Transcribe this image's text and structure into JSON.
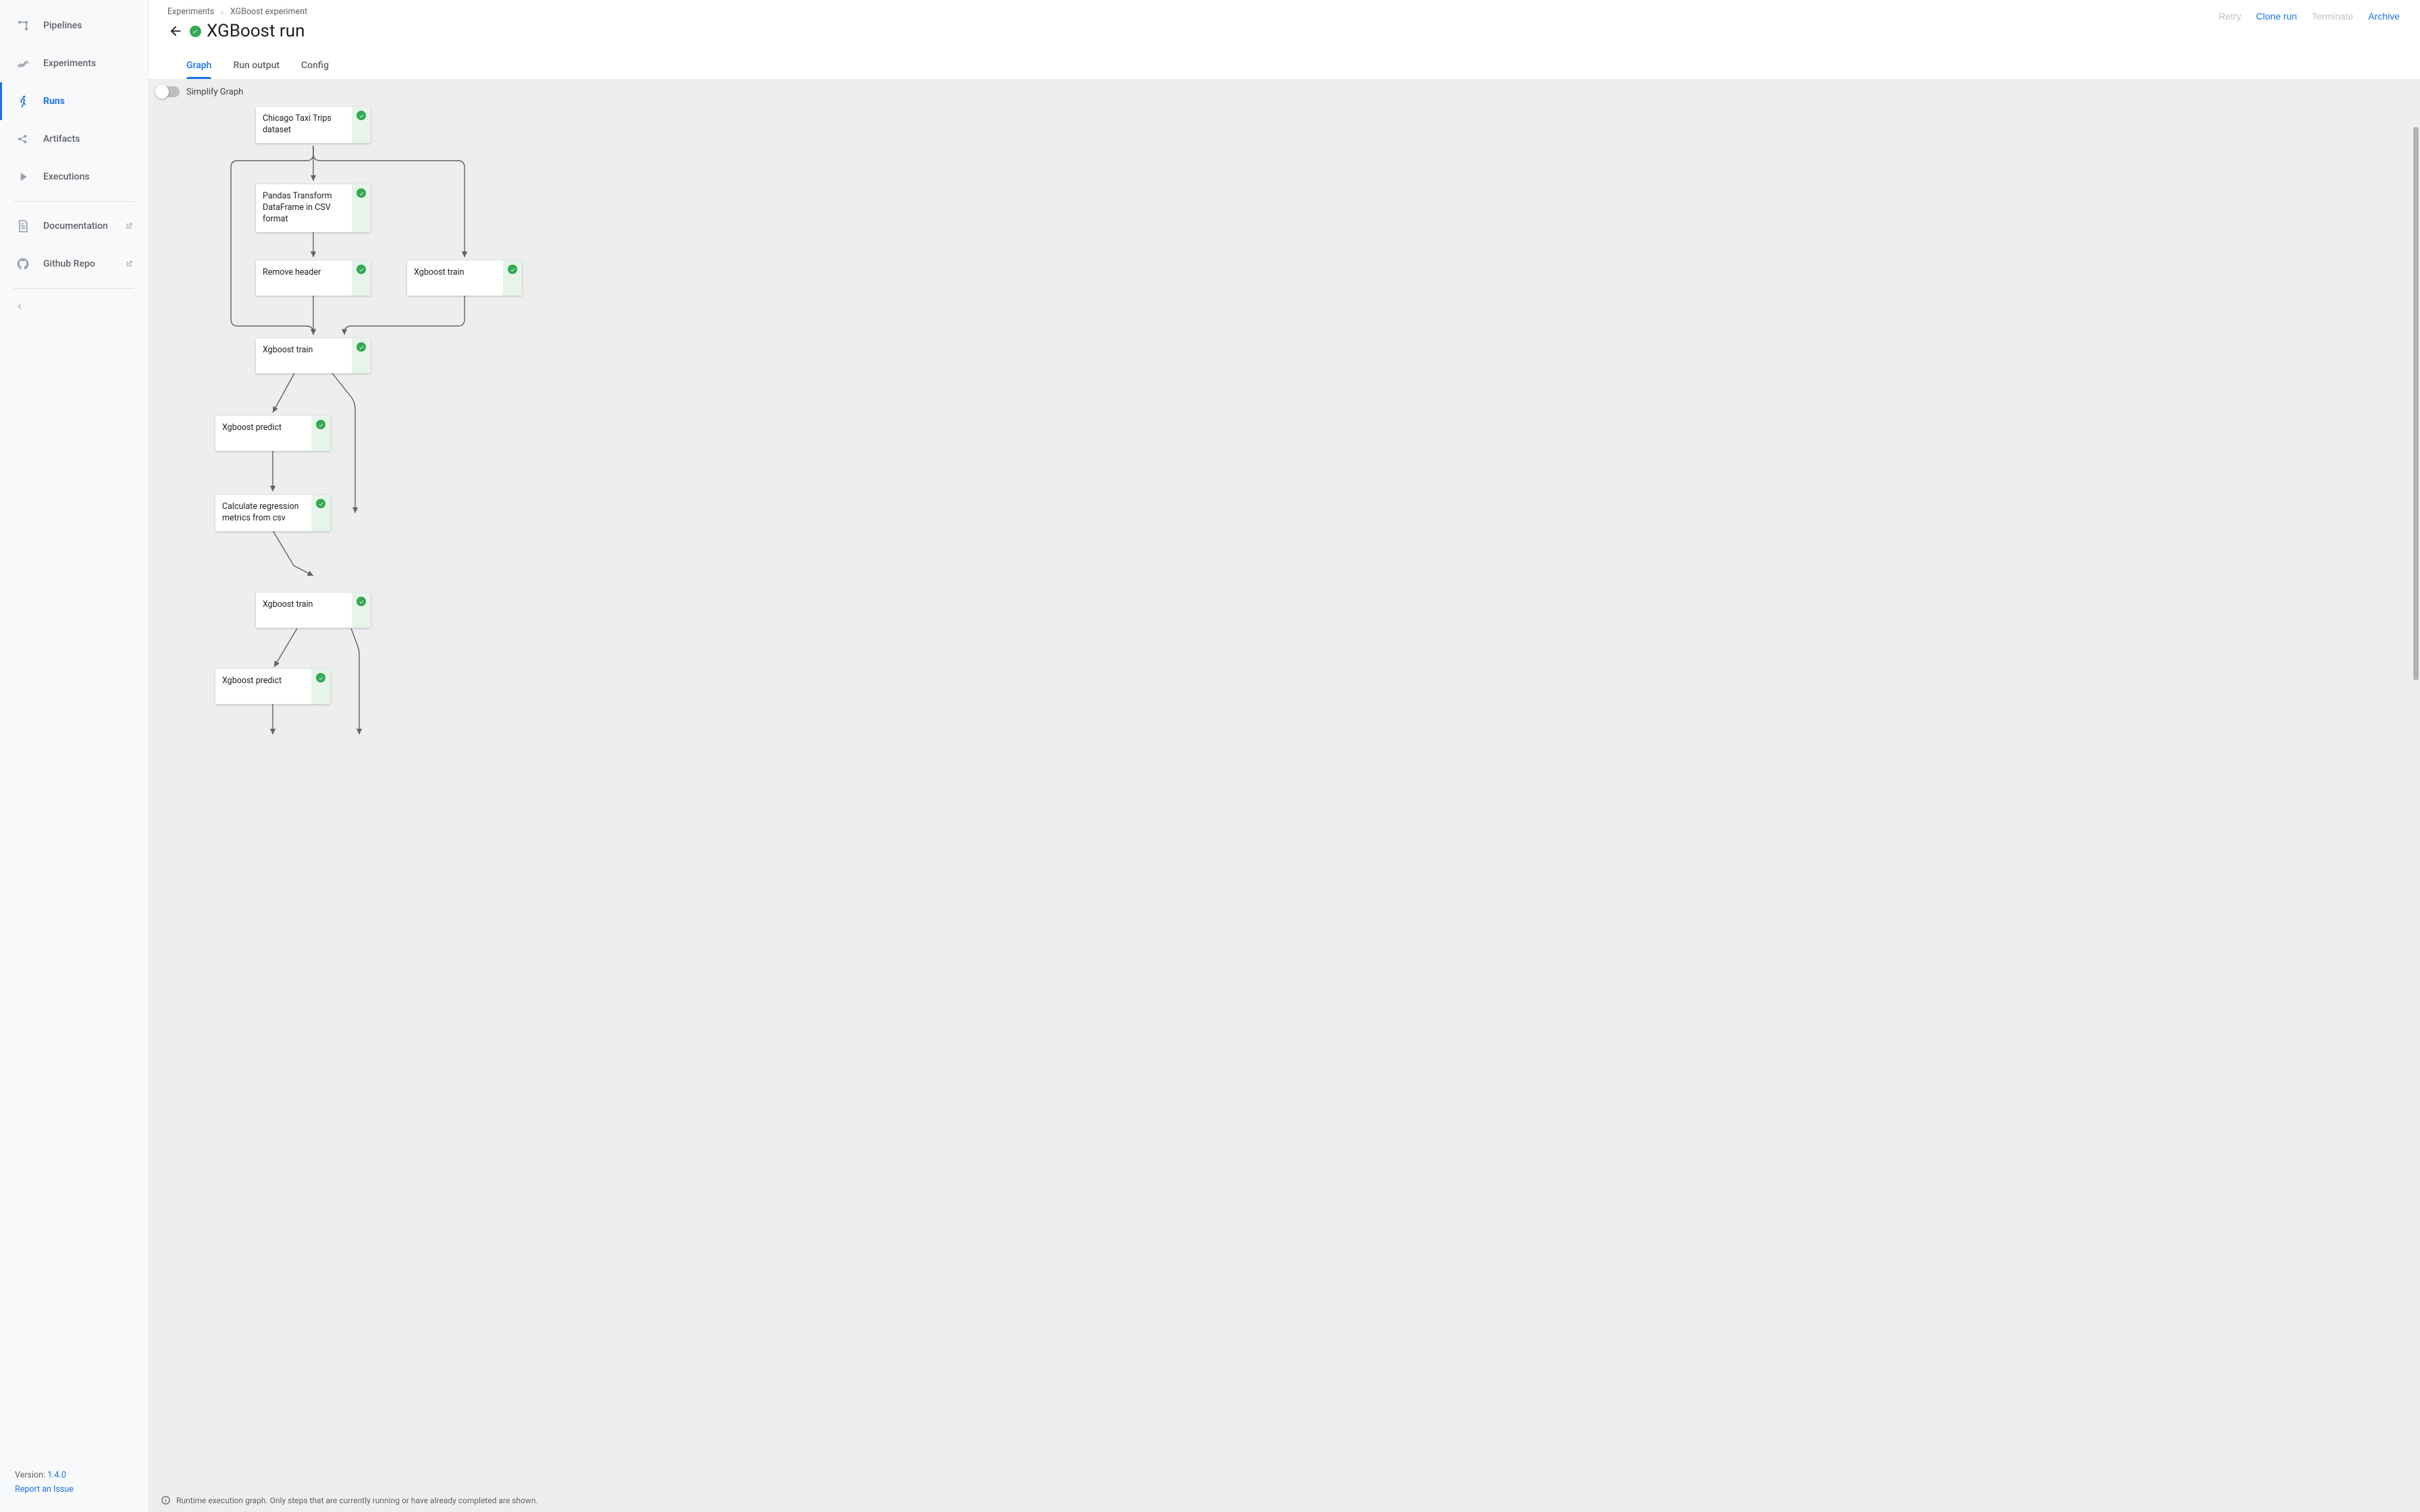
{
  "sidebar": {
    "items": [
      {
        "label": "Pipelines"
      },
      {
        "label": "Experiments"
      },
      {
        "label": "Runs"
      },
      {
        "label": "Artifacts"
      },
      {
        "label": "Executions"
      },
      {
        "label": "Documentation"
      },
      {
        "label": "Github Repo"
      }
    ],
    "version_prefix": "Version: ",
    "version": "1.4.0",
    "report": "Report an Issue"
  },
  "breadcrumb": {
    "0": "Experiments",
    "1": "XGBoost experiment"
  },
  "title": "XGBoost run",
  "actions": {
    "retry": "Retry",
    "clone": "Clone run",
    "terminate": "Terminate",
    "archive": "Archive"
  },
  "tabs": {
    "graph": "Graph",
    "output": "Run output",
    "config": "Config"
  },
  "toolbar": {
    "simplify": "Simplify Graph"
  },
  "nodes": {
    "n0": "Chicago Taxi Trips dataset",
    "n1": "Pandas Transform DataFrame in CSV format",
    "n2": "Remove header",
    "n3": "Xgboost train",
    "n4": "Xgboost train",
    "n5": "Xgboost predict",
    "n6": "Calculate regression metrics from csv",
    "n7": "Xgboost train",
    "n8": "Xgboost predict"
  },
  "footer_note": "Runtime execution graph. Only steps that are currently running or have already completed are shown.",
  "colors": {
    "accent": "#1a73e8",
    "success": "#34a853",
    "bg_canvas": "#eeeeee"
  }
}
